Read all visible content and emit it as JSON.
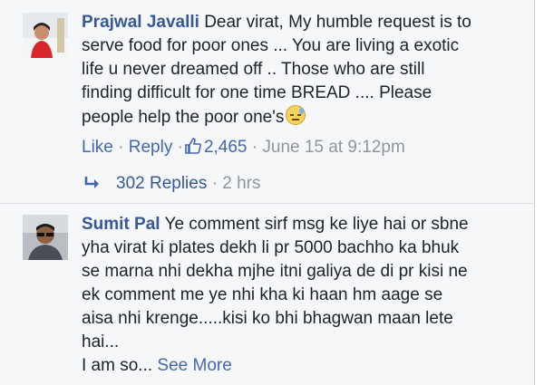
{
  "comment1": {
    "author": "Prajwal Javalli",
    "text_line1": "Dear virat, My humble request is to",
    "text_line2": "serve food for poor ones ... You are living a exotic",
    "text_line3": "life u never dreamed off .. Those who are still",
    "text_line4": "finding difficult for one time BREAD .... Please",
    "text_line5": "people help the poor one's",
    "emoji_icon": "sweat-face-emoji",
    "like_label": "Like",
    "reply_label": "Reply",
    "sep": "·",
    "likes_count": "2,465",
    "timestamp": "June 15 at 9:12pm",
    "replies_label": "302 Replies",
    "replies_time": "2 hrs"
  },
  "comment2": {
    "author": "Sumit Pal",
    "text_line1": "Ye comment sirf msg ke liye hai or sbne",
    "text_line2": "yha virat ki plates dekh li pr 5000 bachho ka bhuk",
    "text_line3": "se marna nhi dekha mjhe itni galiya de di pr kisi ne",
    "text_line4": "ek comment me ye nhi kha ki haan hm aage se",
    "text_line5": "aisa nhi krenge.....kisi ko bhi bhagwan maan lete",
    "text_line6": "hai...",
    "text_line7": "I am so...",
    "see_more": "See More"
  },
  "colors": {
    "author": "#365899",
    "link": "#4267b2",
    "meta": "#90949c",
    "background": "#f6f7f9"
  }
}
